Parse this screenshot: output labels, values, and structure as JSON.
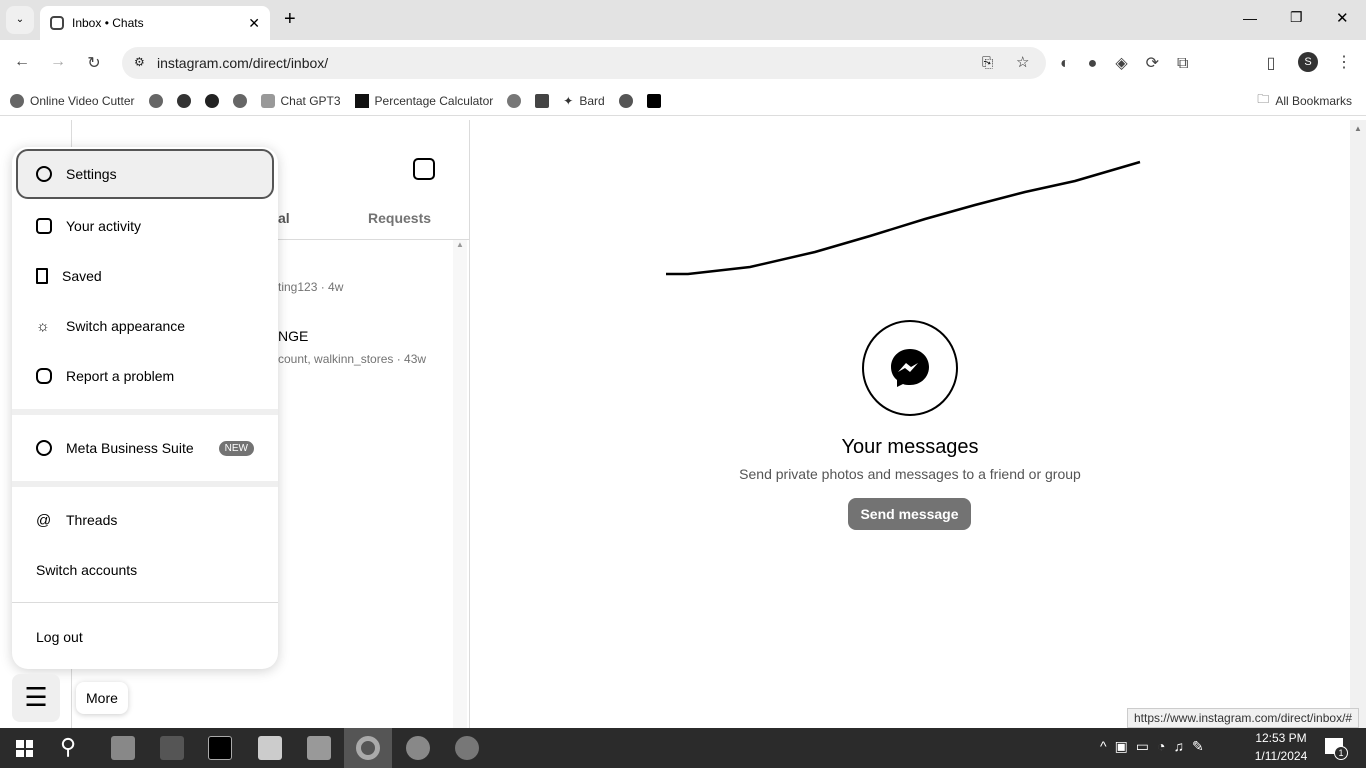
{
  "browser": {
    "tab_title": "Inbox • Chats",
    "url": "instagram.com/direct/inbox/",
    "status_url": "https://www.instagram.com/direct/inbox/#",
    "profile_initial": "S",
    "bookmarks": [
      {
        "label": "Online Video Cutter"
      },
      {
        "label": ""
      },
      {
        "label": ""
      },
      {
        "label": ""
      },
      {
        "label": ""
      },
      {
        "label": "Chat GPT3"
      },
      {
        "label": "Percentage Calculator"
      },
      {
        "label": ""
      },
      {
        "label": ""
      },
      {
        "label": "Bard"
      },
      {
        "label": ""
      },
      {
        "label": ""
      }
    ],
    "all_bookmarks": "All Bookmarks"
  },
  "inbox": {
    "tab_partial": "al",
    "requests_tab": "Requests",
    "threads": [
      {
        "name": "",
        "preview": "ting123 · 4w"
      },
      {
        "name": "NGE",
        "preview": "count, walkinn_stores · 43w"
      }
    ]
  },
  "main": {
    "title": "Your messages",
    "subtitle": "Send private photos and messages to a friend or group",
    "send_button": "Send message"
  },
  "menu": {
    "items": [
      {
        "label": "Settings",
        "icon": "settings-icon"
      },
      {
        "label": "Your activity",
        "icon": "activity-icon"
      },
      {
        "label": "Saved",
        "icon": "bookmark-icon"
      },
      {
        "label": "Switch appearance",
        "icon": "sun-icon"
      },
      {
        "label": "Report a problem",
        "icon": "report-icon"
      },
      {
        "label": "Meta Business Suite",
        "icon": "meta-icon",
        "badge": "NEW"
      },
      {
        "label": "Threads",
        "icon": "threads-icon"
      },
      {
        "label": "Switch accounts"
      },
      {
        "label": "Log out"
      }
    ]
  },
  "more": {
    "label": "More"
  },
  "taskbar": {
    "time": "12:53 PM",
    "date": "1/11/2024",
    "notifications": "1"
  }
}
